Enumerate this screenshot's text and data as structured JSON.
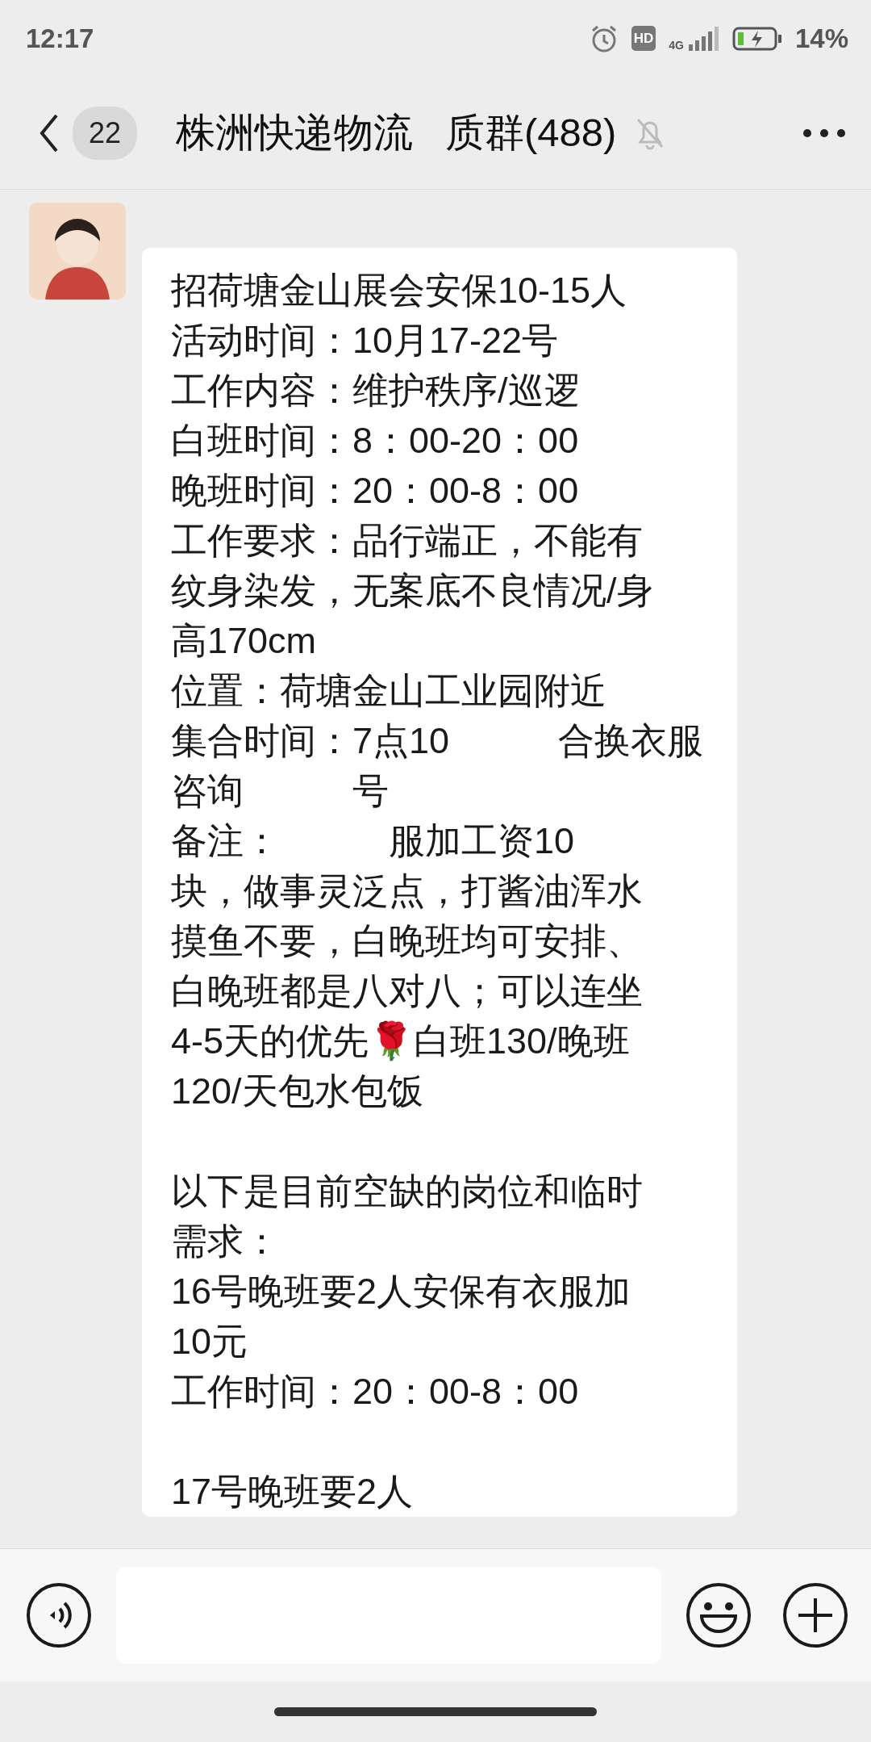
{
  "status_bar": {
    "time": "12:17",
    "hd": "HD",
    "network": "4G",
    "battery": "14%"
  },
  "header": {
    "unread": "22",
    "title_parts": [
      "株洲快递物流",
      "质群(488)"
    ],
    "muted": true
  },
  "messages": [
    {
      "paragraphs": [
        [
          [
            "招荷塘金山展会安保10-15人"
          ],
          [
            "活动时间：10月17-22号"
          ],
          [
            "工作内容：维护秩序/巡逻"
          ],
          [
            "白班时间：8：00-20：00"
          ],
          [
            "晚班时间：20：00-8：00"
          ],
          [
            "工作要求：品行端正，不能有"
          ],
          [
            "纹身染发，无案底不良情况/身"
          ],
          [
            "高170cm"
          ],
          [
            "位置：荷塘金山工业园附近"
          ],
          [
            "集合时间：7点10",
            "合换衣服"
          ],
          [
            "咨询",
            "号"
          ],
          [
            "备注：",
            "服加工资10"
          ],
          [
            "块，做事灵泛点，打酱油浑水"
          ],
          [
            "摸鱼不要，白晚班均可安排、"
          ],
          [
            "白晚班都是八对八；可以连坐"
          ],
          [
            "4-5天的优先🌹白班130/晚班"
          ],
          [
            "120/天包水包饭"
          ]
        ],
        [
          [
            "以下是目前空缺的岗位和临时"
          ],
          [
            "需求："
          ],
          [
            "16号晚班要2人安保有衣服加"
          ],
          [
            "10元"
          ],
          [
            "工作时间：20：00-8：00"
          ]
        ],
        [
          [
            "17号晚班要2人"
          ]
        ]
      ]
    }
  ]
}
